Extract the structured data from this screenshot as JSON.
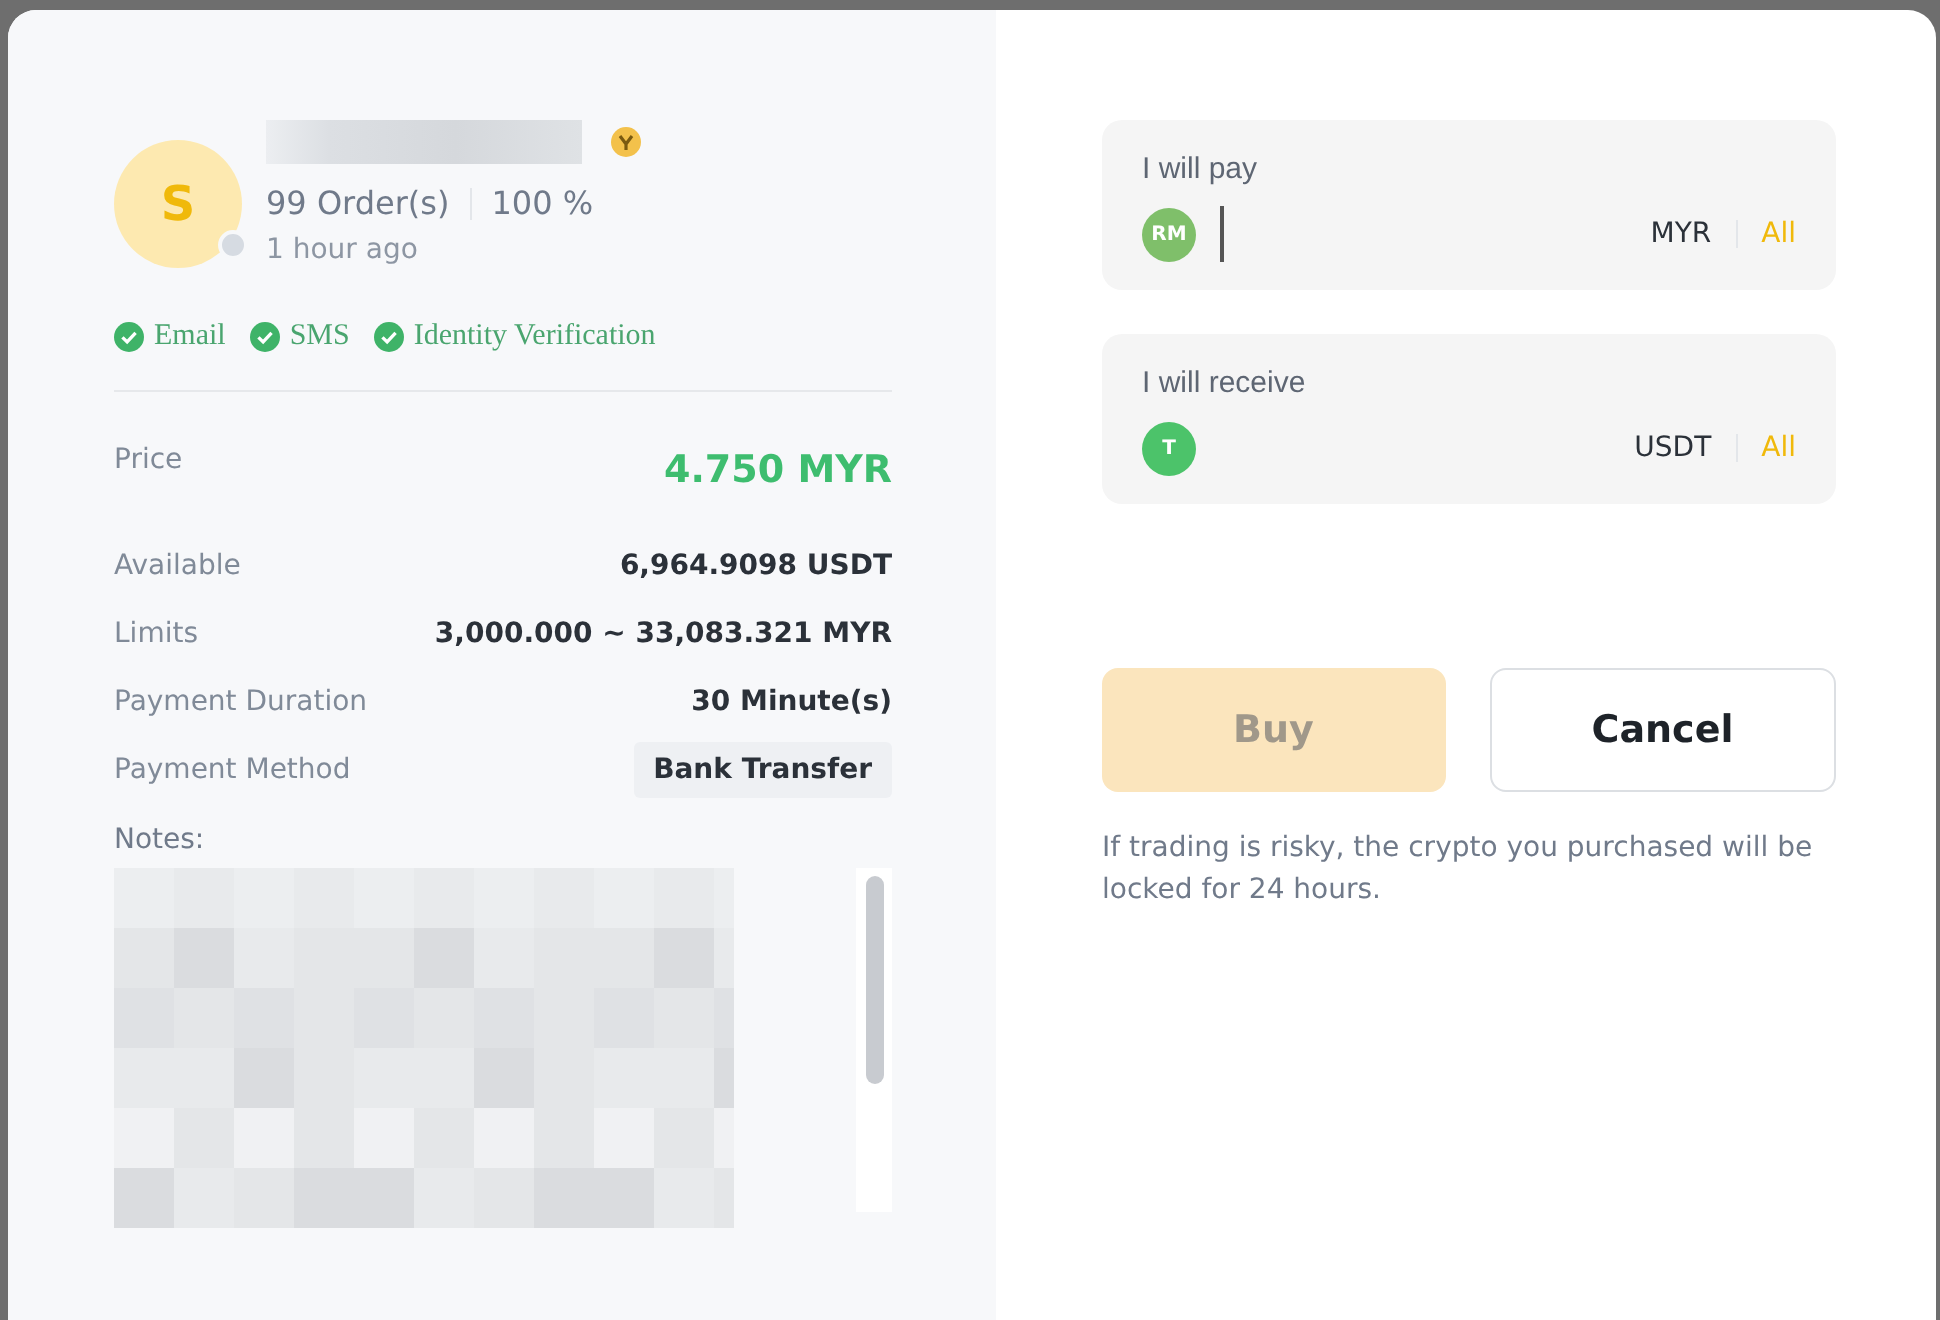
{
  "merchant": {
    "avatar_letter": "S",
    "online": false,
    "orders": "99 Order(s)",
    "completion": "100 %",
    "last_seen": "1 hour ago",
    "verifications": [
      "Email",
      "SMS",
      "Identity Verification"
    ]
  },
  "details": [
    {
      "label": "Price",
      "value": "4.750 MYR",
      "kind": "price"
    },
    {
      "label": "Available",
      "value": "6,964.9098 USDT",
      "kind": "text"
    },
    {
      "label": "Limits",
      "value": "3,000.000 ~ 33,083.321 MYR",
      "kind": "text"
    },
    {
      "label": "Payment Duration",
      "value": "30 Minute(s)",
      "kind": "text"
    },
    {
      "label": "Payment Method",
      "value": "Bank Transfer",
      "kind": "tag"
    }
  ],
  "notes": {
    "label": "Notes:"
  },
  "amounts": [
    {
      "label": "I will pay",
      "coin": "RM",
      "color": "#7fbf6a",
      "currency": "MYR",
      "all": "All",
      "focused": true
    },
    {
      "label": "I will receive",
      "coin": "T",
      "color": "#4cc36a",
      "currency": "USDT",
      "all": "All",
      "focused": false
    }
  ],
  "buttons": [
    {
      "label": "Buy",
      "kind": "primary",
      "disabled": true
    },
    {
      "label": "Cancel",
      "kind": "secondary",
      "disabled": false
    }
  ],
  "disclaimer": "If trading is risky, the crypto you purchased will be locked for 24 hours."
}
